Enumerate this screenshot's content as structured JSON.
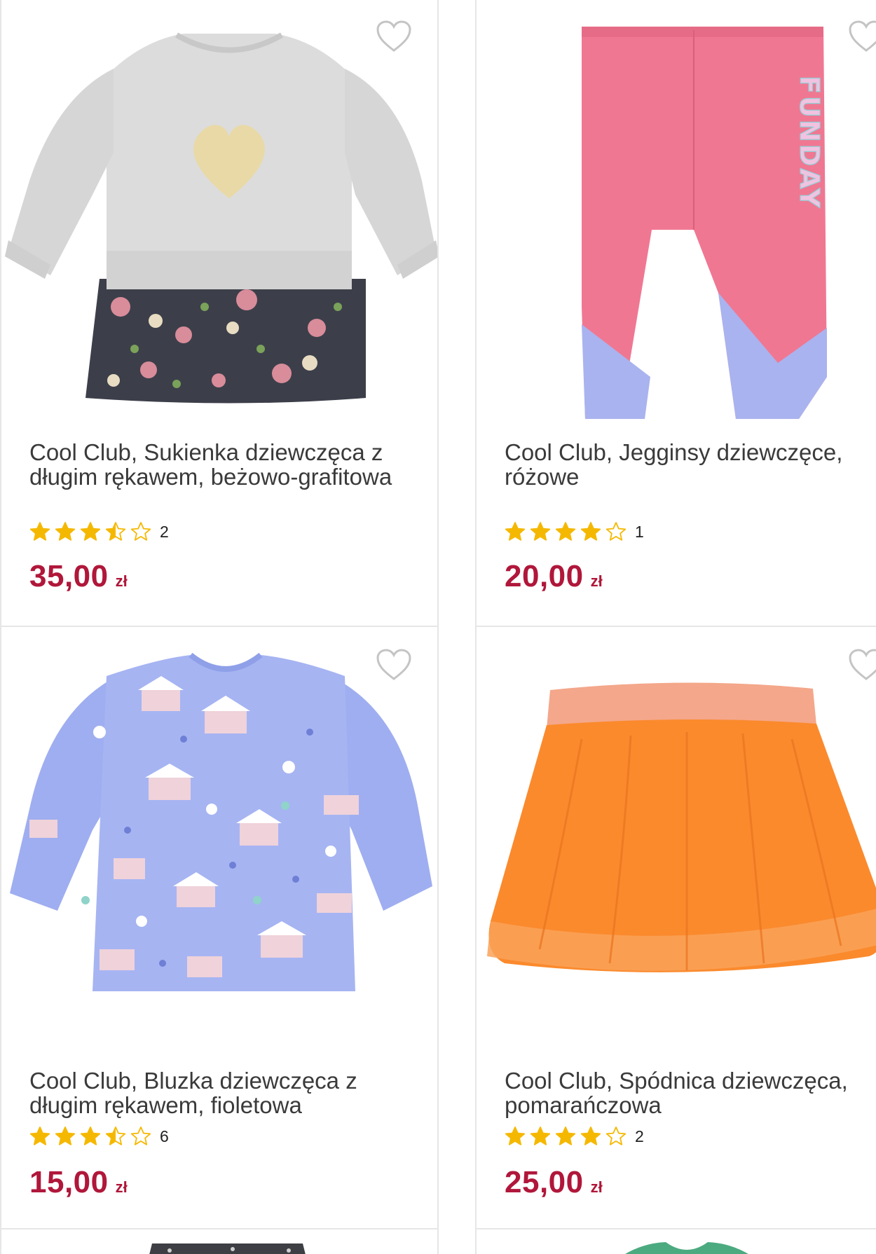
{
  "products": [
    {
      "title": "Cool Club, Sukienka dziewczęca z długim rękawem, beżowo-grafitowa",
      "rating": 3.5,
      "rating_count": "2",
      "price": "35,00",
      "currency": "zł",
      "image_icon": "sweatshirt-dress-image"
    },
    {
      "title": "Cool Club, Jegginsy dziewczęce, różowe",
      "rating": 4,
      "rating_count": "1",
      "price": "20,00",
      "currency": "zł",
      "image_icon": "pink-leggings-image",
      "print_text": "FUNDAY"
    },
    {
      "title": "Cool Club, Bluzka dziewczęca z długim rękawem, fioletowa",
      "rating": 3.5,
      "rating_count": "6",
      "price": "15,00",
      "currency": "zł",
      "image_icon": "blue-blouse-image"
    },
    {
      "title": "Cool Club, Spódnica dziewczęca, pomarańczowa",
      "rating": 4,
      "rating_count": "2",
      "price": "25,00",
      "currency": "zł",
      "image_icon": "orange-tulle-skirt-image"
    }
  ],
  "colors": {
    "price": "#b0173a",
    "star": "#f5b800",
    "border": "#e6e6e6"
  }
}
